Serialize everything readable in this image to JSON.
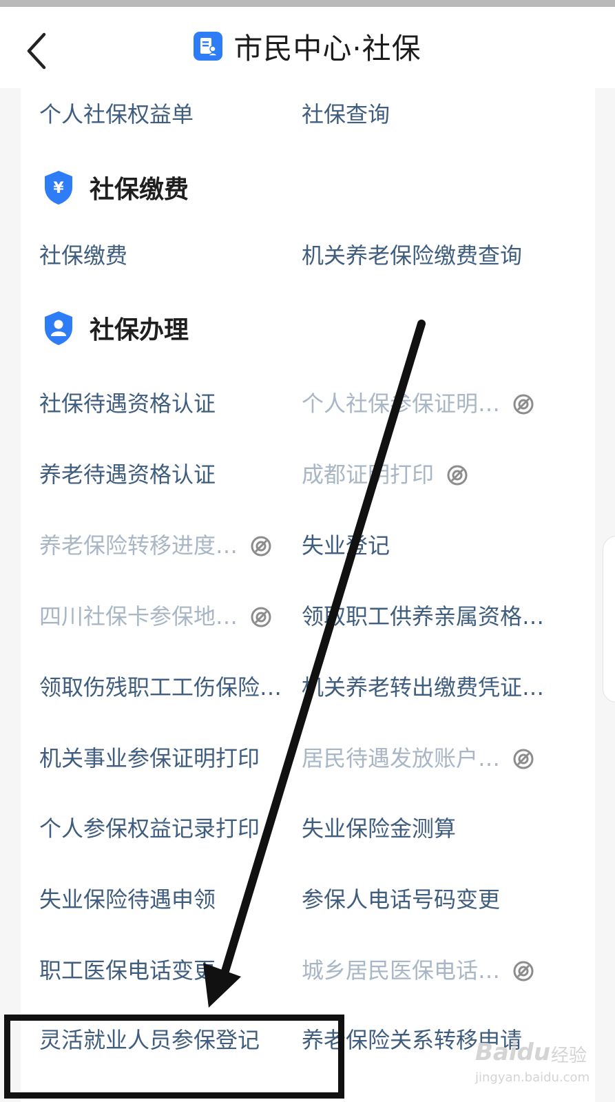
{
  "header": {
    "title": "市民中心·社保"
  },
  "top_items": [
    {
      "label": "个人社保权益单",
      "dimmed": false
    },
    {
      "label": "社保查询",
      "dimmed": false
    }
  ],
  "sections": [
    {
      "title": "社保缴费",
      "icon": "yen-shield-icon",
      "items": [
        {
          "label": "社保缴费",
          "dimmed": false
        },
        {
          "label": "机关养老保险缴费查询",
          "dimmed": false
        }
      ]
    },
    {
      "title": "社保办理",
      "icon": "user-shield-icon",
      "items": [
        {
          "label": "社保待遇资格认证",
          "dimmed": false
        },
        {
          "label": "个人社保参保证明…",
          "dimmed": true,
          "icon": "unavailable-icon"
        },
        {
          "label": "养老待遇资格认证",
          "dimmed": false
        },
        {
          "label": "成都证明打印",
          "dimmed": true,
          "icon": "unavailable-icon"
        },
        {
          "label": "养老保险转移进度…",
          "dimmed": true,
          "icon": "unavailable-icon"
        },
        {
          "label": "失业登记",
          "dimmed": false
        },
        {
          "label": "四川社保卡参保地…",
          "dimmed": true,
          "icon": "unavailable-icon"
        },
        {
          "label": "领取职工供养亲属资格…",
          "dimmed": false
        },
        {
          "label": "领取伤残职工工伤保险…",
          "dimmed": false
        },
        {
          "label": "机关养老转出缴费凭证…",
          "dimmed": false
        },
        {
          "label": "机关事业参保证明打印",
          "dimmed": false
        },
        {
          "label": "居民待遇发放账户…",
          "dimmed": true,
          "icon": "unavailable-icon"
        },
        {
          "label": "个人参保权益记录打印",
          "dimmed": false
        },
        {
          "label": "失业保险金测算",
          "dimmed": false
        },
        {
          "label": "失业保险待遇申领",
          "dimmed": false
        },
        {
          "label": "参保人电话号码变更",
          "dimmed": false
        },
        {
          "label": "职工医保电话变更",
          "dimmed": false
        },
        {
          "label": "城乡居民医保电话…",
          "dimmed": true,
          "icon": "unavailable-icon"
        },
        {
          "label": "灵活就业人员参保登记",
          "dimmed": false
        },
        {
          "label": "养老保险关系转移申请",
          "dimmed": false
        }
      ]
    }
  ],
  "watermark": {
    "logo": "Baidu",
    "suffix": "经验",
    "url": "jingyan.baidu.com"
  },
  "colors": {
    "link": "#3f5d7e",
    "dimmed": "#a9b6c5",
    "accent": "#2f7df6"
  }
}
